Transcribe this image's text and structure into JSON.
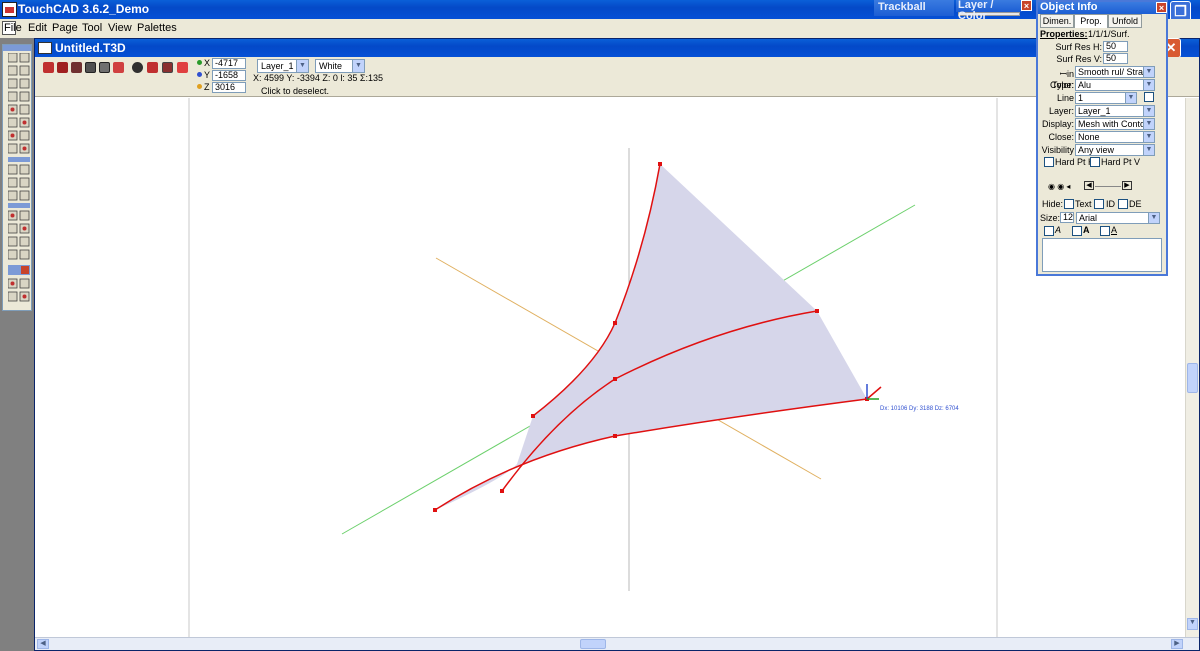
{
  "app": {
    "title": "TouchCAD 3.6.2_Demo"
  },
  "menu": [
    "File",
    "Edit",
    "Page",
    "Tool",
    "View",
    "Palettes"
  ],
  "document": {
    "title": "Untitled.T3D"
  },
  "coords": {
    "x_label": "X",
    "x": "-4717",
    "y_label": "Y",
    "y": "-1658",
    "z_label": "Z",
    "z": "3016"
  },
  "toolbar": {
    "layer": "Layer_1",
    "color": "White",
    "readout": "X: 4599   Y: -3394   Z: 0   l: 35   Σ:135",
    "hint": "Click to deselect."
  },
  "panels": {
    "trackball": "Trackball",
    "layer_color": "Layer / Color"
  },
  "object_info": {
    "title": "Object Info",
    "tabs": [
      "Dimen.",
      "Prop.",
      "Unfold"
    ],
    "properties_label": "Properties:",
    "properties_value": "1/1/1/Surf.",
    "surf_res_h_label": "Surf Res H:",
    "surf_res_h": "50",
    "surf_res_v_label": "Surf Res V:",
    "surf_res_v": "50",
    "skin_type_label": "ꟷin Type:",
    "skin_type": "Smooth  rul/ Stra",
    "color_label": "Color:",
    "color": "Alu",
    "line_label": "Line",
    "line": "1",
    "layer_label": "Layer:",
    "layer": "Layer_1",
    "display_label": "Display:",
    "display": "Mesh with Contou",
    "close_label": "Close:",
    "close": "None",
    "visibility_label": "Visibility",
    "visibility": "Any view",
    "hard_pt_h": "Hard Pt H",
    "hard_pt_v": "Hard Pt V",
    "hide_label": "Hide:",
    "hide_text": "Text",
    "hide_id": "ID",
    "hide_de": "DE",
    "size_label": "Size:",
    "size": "12",
    "font": "Arial"
  },
  "viewport": {
    "dim_readout": "Dx: 10106  Dy: 3188  Dz: 6704",
    "surface_color": "#d6d6ea",
    "curve_color": "#e01010"
  }
}
